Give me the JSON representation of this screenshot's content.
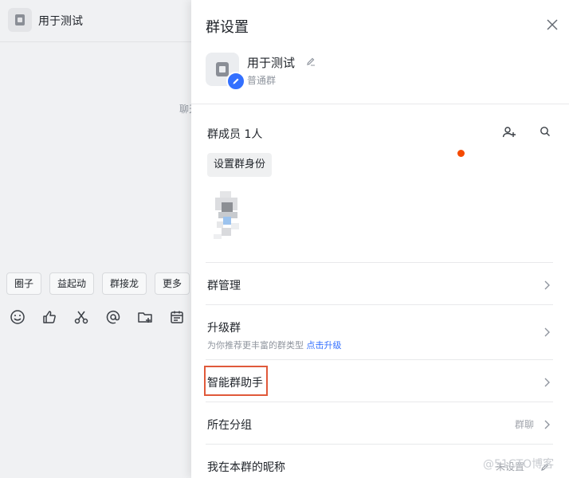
{
  "chat": {
    "title": "用于测试",
    "hint": "聊天",
    "quick_buttons": [
      "圈子",
      "益起动",
      "群接龙",
      "更多"
    ],
    "toolbar_icons": [
      "emoji-icon",
      "thumbs-up-icon",
      "scissors-icon",
      "at-icon",
      "folder-add-icon",
      "calendar-icon"
    ]
  },
  "panel": {
    "title": "群设置",
    "group_name": "用于测试",
    "group_type": "普通群",
    "members_title": "群成员 1人",
    "set_role_label": "设置群身份",
    "rows": {
      "manage": "群管理",
      "upgrade": "升级群",
      "upgrade_sub": "为你推荐更丰富的群类型",
      "upgrade_link": "点击升级",
      "assistant": "智能群助手",
      "group_folder": "所在分组",
      "group_folder_value": "群聊",
      "nickname": "我在本群的昵称",
      "nickname_value": "未设置"
    }
  },
  "watermark": "@51CTO博客",
  "colors": {
    "accent": "#3370ff",
    "badge": "#f54a00",
    "highlight": "#e0593a"
  }
}
